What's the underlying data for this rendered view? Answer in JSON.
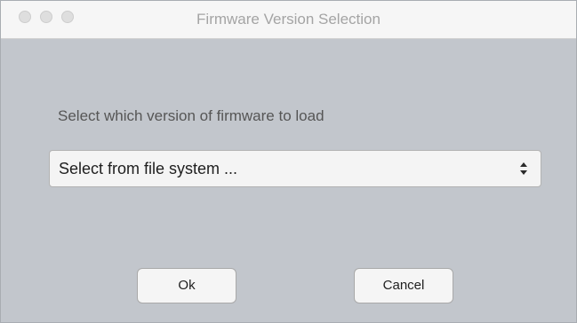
{
  "window": {
    "title": "Firmware Version Selection",
    "controls": [
      {
        "name": "close",
        "icon": "traffic-light-close-icon"
      },
      {
        "name": "minimize",
        "icon": "traffic-light-minimize-icon"
      },
      {
        "name": "zoom",
        "icon": "traffic-light-zoom-icon"
      }
    ]
  },
  "dialog": {
    "prompt": "Select which version of firmware to load",
    "select": {
      "value": "Select from file system ...",
      "icon": "up-down-chevron-icon"
    },
    "buttons": {
      "ok_label": "Ok",
      "cancel_label": "Cancel"
    }
  },
  "colors": {
    "background": "#c2c6cc",
    "titlebar": "#f6f6f6",
    "control_surface": "#f4f4f4"
  }
}
